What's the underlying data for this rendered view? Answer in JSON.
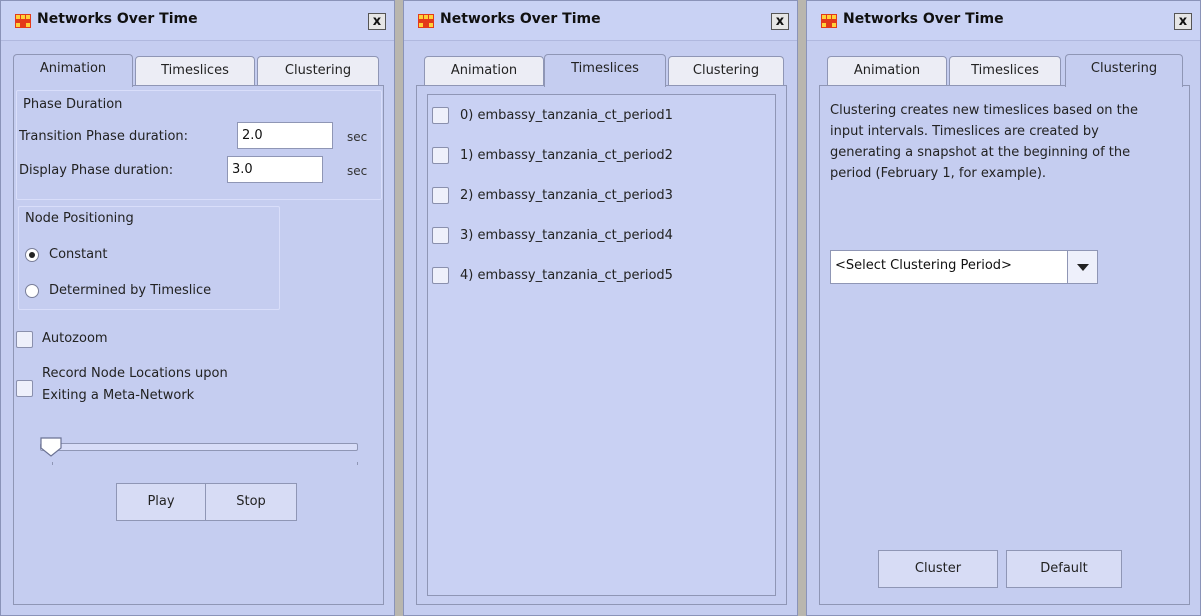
{
  "windows": [
    {
      "title": "Networks Over Time",
      "close_label": "x",
      "tabs": [
        "Animation",
        "Timeslices",
        "Clustering"
      ],
      "active_tab": "Animation"
    },
    {
      "title": "Networks Over Time",
      "close_label": "x",
      "tabs": [
        "Animation",
        "Timeslices",
        "Clustering"
      ],
      "active_tab": "Timeslices"
    },
    {
      "title": "Networks Over Time",
      "close_label": "x",
      "tabs": [
        "Animation",
        "Timeslices",
        "Clustering"
      ],
      "active_tab": "Clustering"
    }
  ],
  "animation": {
    "phase_group_label": "Phase Duration",
    "transition_label": "Transition Phase duration:",
    "transition_value": "2.0",
    "display_label": "Display Phase duration:",
    "display_value": "3.0",
    "unit": "sec",
    "node_group_label": "Node Positioning",
    "constant_label": "Constant",
    "constant_selected": true,
    "determined_label": "Determined by Timeslice",
    "determined_selected": false,
    "autozoom_label": "Autozoom",
    "autozoom_checked": false,
    "record_label_line1": "Record Node Locations upon",
    "record_label_line2": "Exiting a Meta-Network",
    "record_checked": false,
    "slider_position": 0,
    "play_label": "Play",
    "stop_label": "Stop"
  },
  "timeslices": {
    "items": [
      {
        "label": "0) embassy_tanzania_ct_period1",
        "checked": false
      },
      {
        "label": "1) embassy_tanzania_ct_period2",
        "checked": false
      },
      {
        "label": "2) embassy_tanzania_ct_period3",
        "checked": false
      },
      {
        "label": "3) embassy_tanzania_ct_period4",
        "checked": false
      },
      {
        "label": "4) embassy_tanzania_ct_period5",
        "checked": false
      }
    ]
  },
  "clustering": {
    "description": "Clustering creates new timeslices based on the input intervals. Timeslices are created by generating a snapshot at the beginning of the period (February 1, for example).",
    "select_value": "<Select Clustering Period>",
    "cluster_label": "Cluster",
    "default_label": "Default"
  },
  "colors": {
    "window_bg": "#c5cdf0",
    "tab_inactive": "#ecedf5",
    "border": "#8f96b5",
    "icon_red": "#e33a1a",
    "icon_yellow": "#ffd23a"
  }
}
